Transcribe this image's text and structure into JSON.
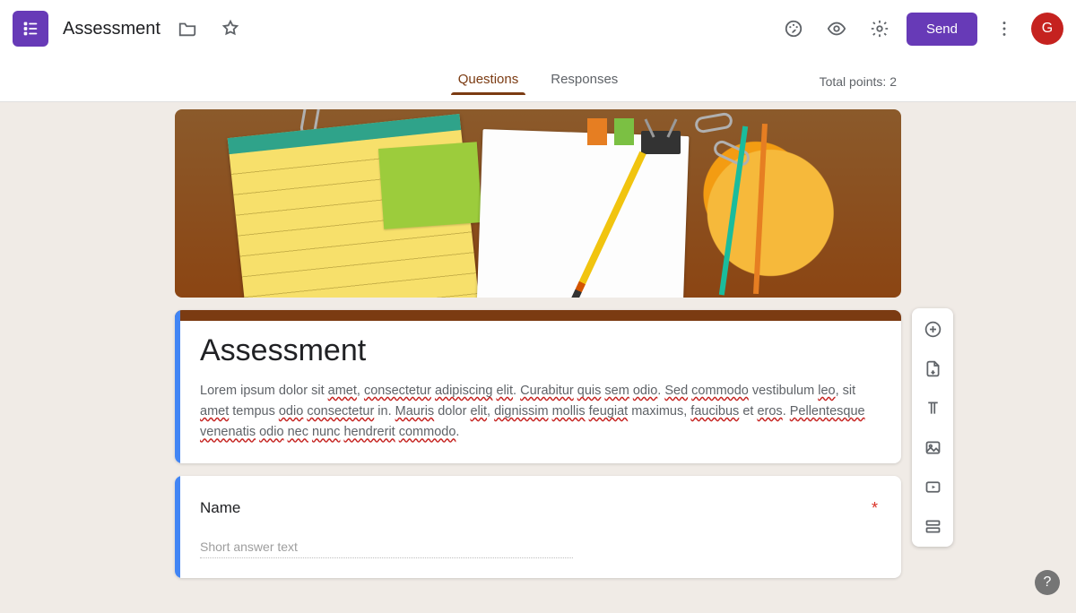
{
  "header": {
    "doc_title": "Assessment",
    "send_label": "Send",
    "avatar_letter": "G"
  },
  "tabs": {
    "questions": "Questions",
    "responses": "Responses",
    "active": "questions"
  },
  "points": {
    "label_prefix": "Total points: ",
    "value": 2
  },
  "title_card": {
    "title": "Assessment",
    "description_parts": [
      {
        "t": "Lorem ipsum dolor sit "
      },
      {
        "t": "amet",
        "u": true
      },
      {
        "t": ", "
      },
      {
        "t": "consectetur",
        "u": true
      },
      {
        "t": " "
      },
      {
        "t": "adipiscing",
        "u": true
      },
      {
        "t": " "
      },
      {
        "t": "elit",
        "u": true
      },
      {
        "t": ". "
      },
      {
        "t": "Curabitur",
        "u": true
      },
      {
        "t": " "
      },
      {
        "t": "quis",
        "u": true
      },
      {
        "t": " "
      },
      {
        "t": "sem",
        "u": true
      },
      {
        "t": " "
      },
      {
        "t": "odio",
        "u": true
      },
      {
        "t": ". "
      },
      {
        "t": "Sed",
        "u": true
      },
      {
        "t": " "
      },
      {
        "t": "commodo",
        "u": true
      },
      {
        "t": " vestibulum "
      },
      {
        "t": "leo",
        "u": true
      },
      {
        "t": ", sit "
      },
      {
        "t": "amet",
        "u": true
      },
      {
        "t": " tempus "
      },
      {
        "t": "odio",
        "u": true
      },
      {
        "t": " "
      },
      {
        "t": "consectetur",
        "u": true
      },
      {
        "t": " in. "
      },
      {
        "t": "Mauris",
        "u": true
      },
      {
        "t": " dolor "
      },
      {
        "t": "elit",
        "u": true
      },
      {
        "t": ", "
      },
      {
        "t": "dignissim",
        "u": true
      },
      {
        "t": " "
      },
      {
        "t": "mollis",
        "u": true
      },
      {
        "t": " "
      },
      {
        "t": "feugiat",
        "u": true
      },
      {
        "t": " maximus, "
      },
      {
        "t": "faucibus",
        "u": true
      },
      {
        "t": " et "
      },
      {
        "t": "eros",
        "u": true
      },
      {
        "t": ". "
      },
      {
        "t": "Pellentesque",
        "u": true
      },
      {
        "t": " "
      },
      {
        "t": "venenatis",
        "u": true
      },
      {
        "t": " "
      },
      {
        "t": "odio",
        "u": true
      },
      {
        "t": " "
      },
      {
        "t": "nec",
        "u": true
      },
      {
        "t": " "
      },
      {
        "t": "nunc",
        "u": true
      },
      {
        "t": " "
      },
      {
        "t": "hendrerit",
        "u": true
      },
      {
        "t": " "
      },
      {
        "t": "commodo",
        "u": true
      },
      {
        "t": "."
      }
    ]
  },
  "question1": {
    "label": "Name",
    "required": true,
    "placeholder": "Short answer text"
  },
  "side_tools": {
    "add_question": "add-question",
    "import_questions": "import-questions",
    "add_title": "add-title-description",
    "add_image": "add-image",
    "add_video": "add-video",
    "add_section": "add-section"
  },
  "help": "?"
}
